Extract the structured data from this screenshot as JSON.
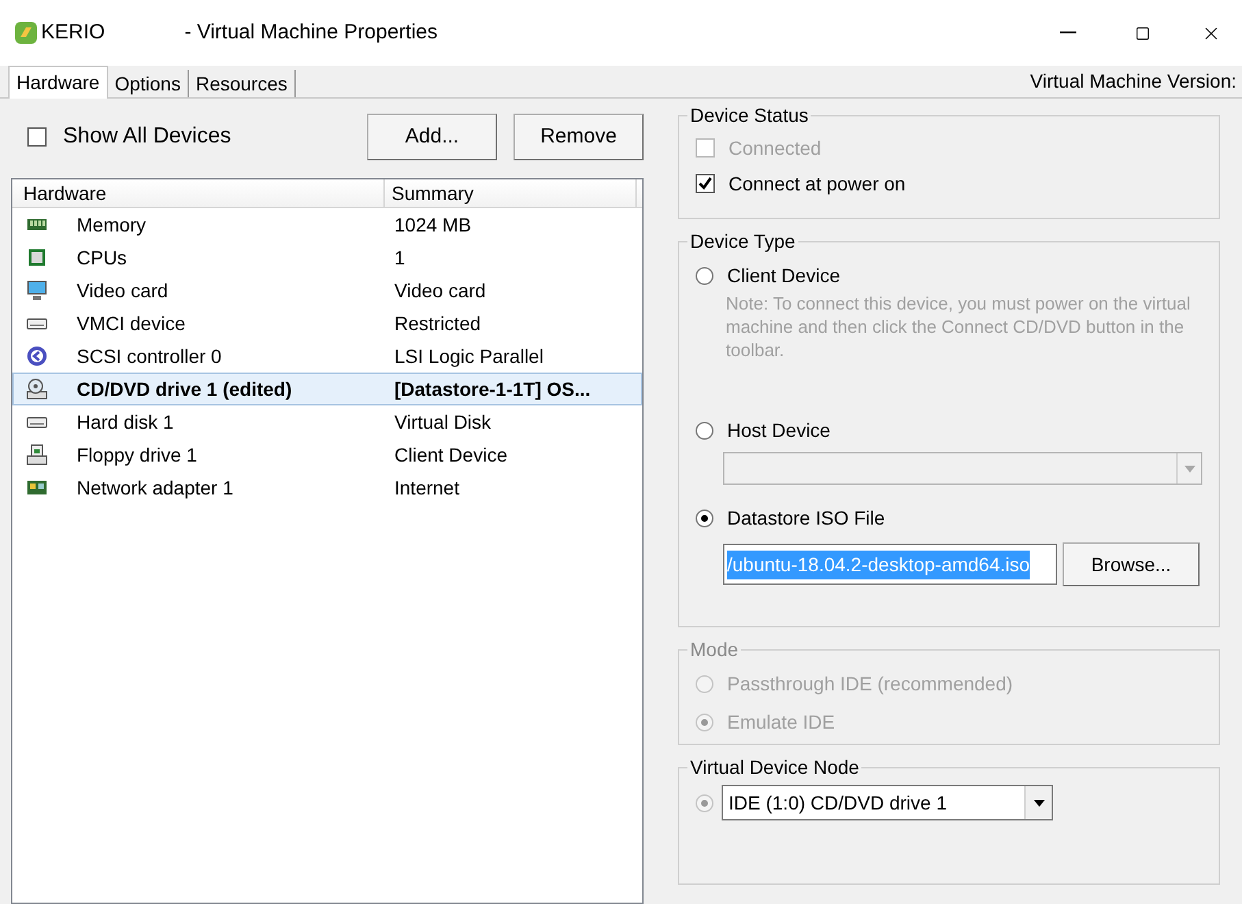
{
  "window": {
    "app": "KERIO",
    "title": "- Virtual Machine Properties"
  },
  "tabs": [
    {
      "label": "Hardware",
      "selected": true
    },
    {
      "label": "Options",
      "selected": false
    },
    {
      "label": "Resources",
      "selected": false
    }
  ],
  "version_label": "Virtual Machine Version:",
  "show_all_devices": {
    "label": "Show All Devices",
    "checked": false
  },
  "buttons": [
    "Add...",
    "Remove"
  ],
  "hardware_table": {
    "columns": [
      "Hardware",
      "Summary"
    ],
    "rows": [
      {
        "kind": "memory",
        "name": "Memory",
        "summary": "1024 MB",
        "selected": false
      },
      {
        "kind": "cpu",
        "name": "CPUs",
        "summary": "1",
        "selected": false
      },
      {
        "kind": "video",
        "name": "Video card",
        "summary": "Video card",
        "selected": false
      },
      {
        "kind": "pci",
        "name": "VMCI device",
        "summary": "Restricted",
        "selected": false
      },
      {
        "kind": "scsi",
        "name": "SCSI controller 0",
        "summary": "LSI Logic Parallel",
        "selected": false
      },
      {
        "kind": "cdrom",
        "name": "CD/DVD drive 1 (edited)",
        "summary": "[Datastore-1-1T] OS...",
        "selected": true
      },
      {
        "kind": "disk",
        "name": "Hard disk 1",
        "summary": "Virtual Disk",
        "selected": false
      },
      {
        "kind": "floppy",
        "name": "Floppy drive 1",
        "summary": "Client Device",
        "selected": false
      },
      {
        "kind": "network",
        "name": "Network adapter 1",
        "summary": "Internet",
        "selected": false
      }
    ]
  },
  "device_status": {
    "title": "Device Status",
    "options": [
      {
        "label": "Connected",
        "checked": false,
        "disabled": true
      },
      {
        "label": "Connect at power on",
        "checked": true,
        "disabled": false
      }
    ]
  },
  "device_type": {
    "title": "Device Type",
    "options": [
      {
        "kind": "client",
        "label": "Client Device",
        "selected": false,
        "note": "Note: To connect this device, you must power on the virtual machine and then click the Connect CD/DVD button in the toolbar."
      },
      {
        "kind": "host",
        "label": "Host Device",
        "selected": false,
        "dropdown_disabled": true
      },
      {
        "kind": "iso",
        "label": "Datastore ISO File",
        "selected": true,
        "value": "/ubuntu-18.04.2-desktop-amd64.iso",
        "button": "Browse..."
      }
    ]
  },
  "mode": {
    "title": "Mode",
    "disabled": true,
    "options": [
      {
        "label": "Passthrough IDE (recommended)",
        "selected": false
      },
      {
        "label": "Emulate IDE",
        "selected": true
      }
    ]
  },
  "virtual_device_node": {
    "title": "Virtual Device Node",
    "selected": true,
    "disabled": true,
    "value": "IDE (1:0) CD/DVD drive 1"
  }
}
